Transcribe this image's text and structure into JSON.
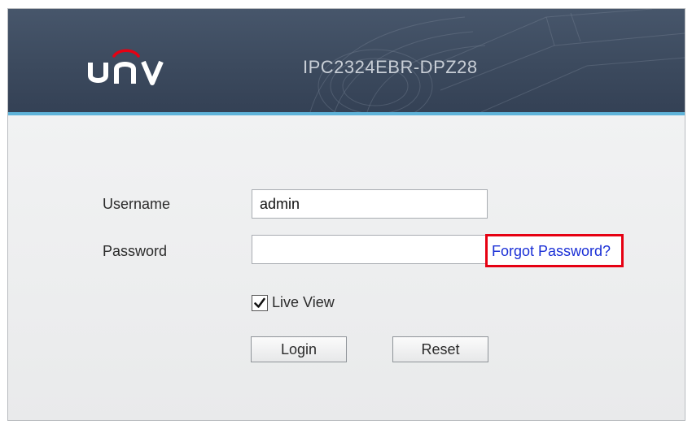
{
  "header": {
    "brand": "UNV",
    "model": "IPC2324EBR-DPZ28"
  },
  "form": {
    "username_label": "Username",
    "username_value": "admin",
    "password_label": "Password",
    "password_value": "",
    "forgot_password": "Forgot Password?",
    "live_view_label": "Live View",
    "live_view_checked": true,
    "login_button": "Login",
    "reset_button": "Reset"
  },
  "colors": {
    "header_bg": "#3f4d61",
    "header_accent": "#5fb3d9",
    "highlight_border": "#e60012",
    "link": "#1a2fd6",
    "logo_arc": "#e60012"
  },
  "icons": {
    "logo": "unv-logo",
    "checkbox": "checkmark-icon"
  }
}
